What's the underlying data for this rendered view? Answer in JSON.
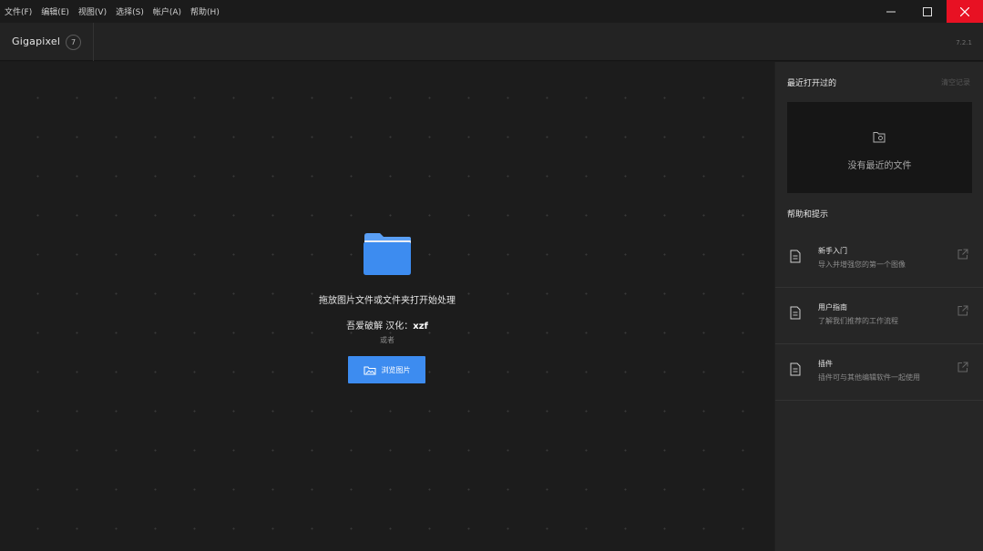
{
  "menu": {
    "items": [
      "文件(F)",
      "编辑(E)",
      "视图(V)",
      "选择(S)",
      "帐户(A)",
      "帮助(H)"
    ]
  },
  "window_controls": {
    "minimize_icon": "minimize-icon",
    "maximize_icon": "maximize-icon",
    "close_icon": "close-icon",
    "close_color": "#e81123"
  },
  "app": {
    "name": "Gigapixel",
    "badge": "7",
    "version": "7.2.1"
  },
  "main": {
    "drop_text": "拖放图片文件或文件夹打开始处理",
    "credit_prefix": "吾爱破解 汉化：",
    "credit_name": "xzf",
    "or_text": "或者",
    "browse_label": "浏览图片",
    "accent_color": "#3d8cf0",
    "folder_icon": "folder-icon"
  },
  "sidebar": {
    "recent_title": "最近打开过的",
    "clear_label": "清空记录",
    "recent_empty": "没有最近的文件",
    "help_title": "帮助和提示",
    "help_items": [
      {
        "title": "新手入门",
        "desc": "导入并增强您的第一个图像"
      },
      {
        "title": "用户指南",
        "desc": "了解我们推荐的工作流程"
      },
      {
        "title": "插件",
        "desc": "插件可与其他编辑软件一起使用"
      }
    ]
  }
}
